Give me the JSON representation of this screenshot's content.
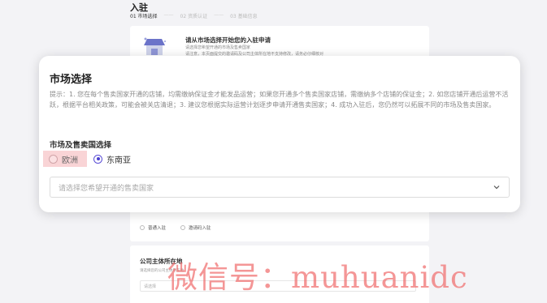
{
  "page": {
    "title": "入驻",
    "steps": [
      "01 市场选择",
      "02 资质认证",
      "03 基础信息"
    ],
    "separator": "——"
  },
  "intro_card": {
    "heading": "请从市场选择开始您的入驻申请",
    "sub1": "请选择您希望开通的市场及售卖国家",
    "sub2": "请注意，本页面提交的邀请码及公司主体所在地不支持修改，请务必仔细核对",
    "entry_types": [
      "普通入驻",
      "邀请码入驻"
    ]
  },
  "company_section": {
    "title": "公司主体所在地",
    "subtitle": "请选择您的公司主体所在地",
    "placeholder": "请选择"
  },
  "modal": {
    "title": "市场选择",
    "hint": "提示：1. 您在每个售卖国家开通的店铺，均需缴纳保证金才能发品运营；如果您开通多个售卖国家店铺，需缴纳多个店铺的保证金；2. 如您店铺开通后运营不活跃，根据平台相关政策，可能会被关店清退；3. 建议您根据实际运营计划逐步申请开通售卖国家；4. 成功入驻后，您仍然可以拓展不同的市场及售卖国家。",
    "section_label": "市场及售卖国选择",
    "markets": [
      {
        "label": "欧洲",
        "selected": false
      },
      {
        "label": "东南亚",
        "selected": true
      }
    ],
    "country_select_placeholder": "请选择您希望开通的售卖国家"
  },
  "watermark": "微信号：muhuanidc",
  "colors": {
    "accent": "#4a3fcf",
    "highlight": "#f9d4d6",
    "watermark": "#f06e6e"
  },
  "icons": {
    "store": "store-icon",
    "chevron": "chevron-down-icon"
  }
}
